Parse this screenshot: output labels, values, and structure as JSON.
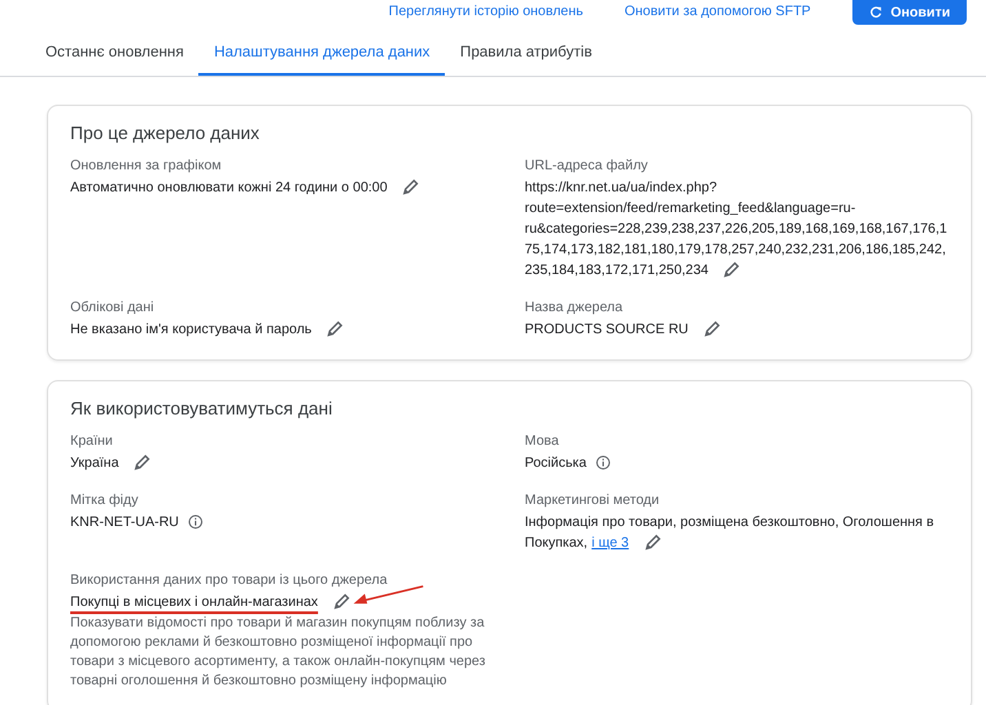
{
  "header": {
    "links": [
      "Переглянути історію оновлень",
      "Оновити за допомогою SFTP"
    ],
    "primary_button": "Оновити"
  },
  "tabs": [
    {
      "label": "Останнє оновлення",
      "selected": false
    },
    {
      "label": "Налаштування джерела даних",
      "selected": true
    },
    {
      "label": "Правила атрибутів",
      "selected": false
    }
  ],
  "cards": [
    {
      "title": "Про це джерело даних",
      "fields": [
        {
          "label": "Оновлення за графіком",
          "value": "Автоматично оновлювати кожні 24 години о 00:00",
          "kind": "edit",
          "annotated": false
        },
        {
          "label": "URL-адреса файлу",
          "value": "https://knr.net.ua/ua/index.php?route=extension/feed/remarketing_feed&language=ru-ru&categories=228,239,238,237,226,205,189,168,169,168,167,176,175,174,173,182,181,180,179,178,257,240,232,231,206,186,185,242,235,184,183,172,171,250,234",
          "kind": "edit",
          "annotated": false
        },
        {
          "label": "Облікові дані",
          "value": "Не вказано ім'я користувача й пароль",
          "kind": "edit",
          "annotated": false
        },
        {
          "label": "Назва джерела",
          "value": "PRODUCTS SOURCE RU",
          "kind": "edit",
          "annotated": false
        }
      ]
    },
    {
      "title": "Як використовуватимуться дані",
      "fields": [
        {
          "label": "Країни",
          "value": "Україна",
          "kind": "edit",
          "annotated": false
        },
        {
          "label": "Мова",
          "value": "Російська",
          "kind": "info",
          "annotated": false
        },
        {
          "label": "Мітка фіду",
          "value": "KNR-NET-UA-RU",
          "kind": "info",
          "annotated": false
        },
        {
          "label": "Маркетингові методи",
          "value": "Інформація про товари, розміщена безкоштовно, Оголошення в Покупках,",
          "link": "і ще 3",
          "kind": "edit",
          "annotated": false
        },
        {
          "label": "Використання даних про товари із цього джерела",
          "value": "Покупці в місцевих і онлайн-магазинах",
          "kind": "edit",
          "annotated": true,
          "description": "Показувати відомості про товари й магазин покупцям поблизу за допомогою реклами й безкоштовно розміщеної інформації про товари з місцевого асортименту, а також онлайн-покупцям через товарні оголошення й безкоштовно розміщену інформацію"
        }
      ]
    }
  ]
}
